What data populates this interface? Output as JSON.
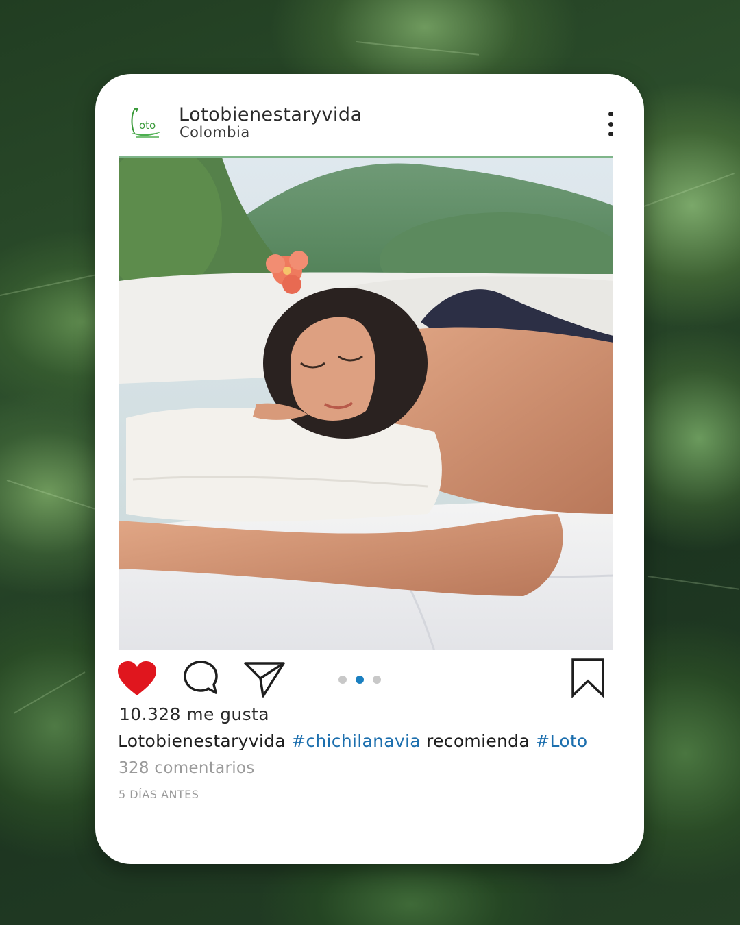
{
  "post": {
    "account": {
      "name": "Lotobienestaryvida",
      "location": "Colombia",
      "logo_text": "Loto"
    },
    "image_icon": "spa-photo",
    "carousel": {
      "count": 3,
      "active_index": 1
    },
    "likes_text": "10.328 me gusta",
    "caption": {
      "username": "Lotobienestaryvida",
      "hashtag_1": "#chichilanavia",
      "text": "recomienda",
      "hashtag_2": "#Loto"
    },
    "comments_text": "328 comentarios",
    "timestamp": "5 DÍAS ANTES",
    "icons": {
      "like": "heart-icon",
      "comment": "comment-icon",
      "share": "send-icon",
      "save": "bookmark-icon",
      "menu": "more-vertical-icon"
    },
    "colors": {
      "like_active": "#e0161e",
      "hashtag": "#1c6fae",
      "active_dot": "#1a7fc0",
      "logo_green": "#3a9a3a"
    }
  }
}
